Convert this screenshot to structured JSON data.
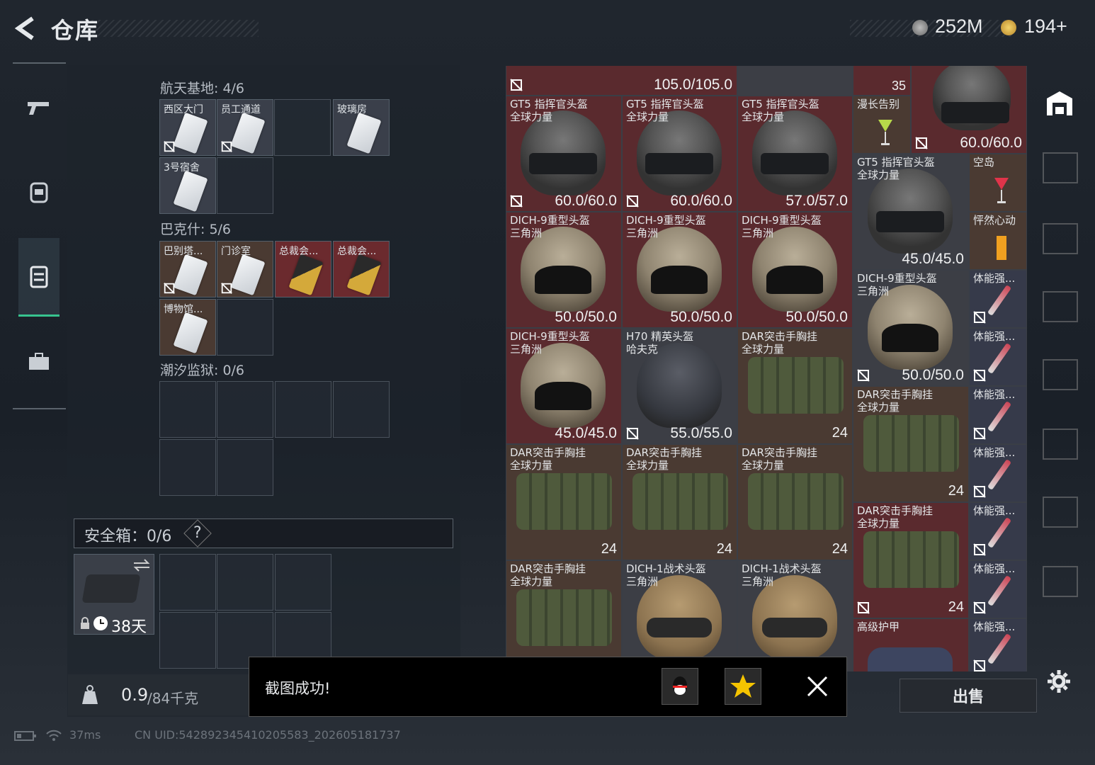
{
  "header": {
    "title": "仓库",
    "currency1": "252M",
    "currency2": "194+"
  },
  "nav": {
    "items": [
      "weapon",
      "backpack",
      "vest",
      "case"
    ]
  },
  "left": {
    "sections": [
      {
        "label": "航天基地: 4/6",
        "cards": [
          "西区大门",
          "员工通道",
          "",
          "玻璃房",
          "3号宿舍"
        ]
      },
      {
        "label": "巴克什: 5/6",
        "cards": [
          "巴别塔...",
          "门诊室",
          "总裁会...",
          "总裁会...",
          "博物馆..."
        ]
      },
      {
        "label": "潮汐监狱: 0/6"
      }
    ],
    "safe_label": "安全箱：0/6",
    "safe_help": "?",
    "safe_days": "38天",
    "weight": "0.9",
    "weight_max": "/84千克"
  },
  "inventory": {
    "top_row": [
      "105.0/105.0",
      "35",
      "60.0/60.0"
    ],
    "items": [
      {
        "name": "GT5 指挥官头盔",
        "sub": "全球力量",
        "val": "60.0/60.0"
      },
      {
        "name": "GT5 指挥官头盔",
        "sub": "全球力量",
        "val": "60.0/60.0"
      },
      {
        "name": "GT5 指挥官头盔",
        "sub": "全球力量",
        "val": "57.0/57.0"
      },
      {
        "name": "漫长告别",
        "sub": ""
      },
      {
        "name": "GT5 指挥官头盔",
        "sub": "全球力量",
        "val": "45.0/45.0"
      },
      {
        "name": "空岛",
        "sub": ""
      },
      {
        "name": "怦然心动",
        "sub": ""
      },
      {
        "name": "DICH-9重型头盔",
        "sub": "三角洲",
        "val": "50.0/50.0"
      },
      {
        "name": "DICH-9重型头盔",
        "sub": "三角洲",
        "val": "50.0/50.0"
      },
      {
        "name": "DICH-9重型头盔",
        "sub": "三角洲",
        "val": "50.0/50.0"
      },
      {
        "name": "DICH-9重型头盔",
        "sub": "三角洲",
        "val": "50.0/50.0"
      },
      {
        "name": "体能强...",
        "sub": ""
      },
      {
        "name": "DICH-9重型头盔",
        "sub": "三角洲",
        "val": "45.0/45.0"
      },
      {
        "name": "H70 精英头盔",
        "sub": "哈夫克",
        "val": "55.0/55.0"
      },
      {
        "name": "DAR突击手胸挂",
        "sub": "全球力量",
        "val": "24"
      },
      {
        "name": "DAR突击手胸挂",
        "sub": "全球力量",
        "val": "24"
      },
      {
        "name": "DAR突击手胸挂",
        "sub": "全球力量",
        "val": "24"
      },
      {
        "name": "DAR突击手胸挂",
        "sub": "全球力量",
        "val": "24"
      },
      {
        "name": "DAR突击手胸挂",
        "sub": "全球力量",
        "val": "24"
      },
      {
        "name": "DAR突击手胸挂",
        "sub": "全球力量",
        "val": "24"
      },
      {
        "name": "DAR突击手胸挂",
        "sub": "全球力量"
      },
      {
        "name": "DICH-1战术头盔",
        "sub": "三角洲"
      },
      {
        "name": "DICH-1战术头盔",
        "sub": "三角洲"
      },
      {
        "name": "高级护甲",
        "sub": ""
      }
    ]
  },
  "toast": {
    "text": "截图成功!"
  },
  "sell": "出售",
  "status": {
    "ping": "37ms",
    "uid": "CN UID:542892345410205583_202605181737"
  }
}
